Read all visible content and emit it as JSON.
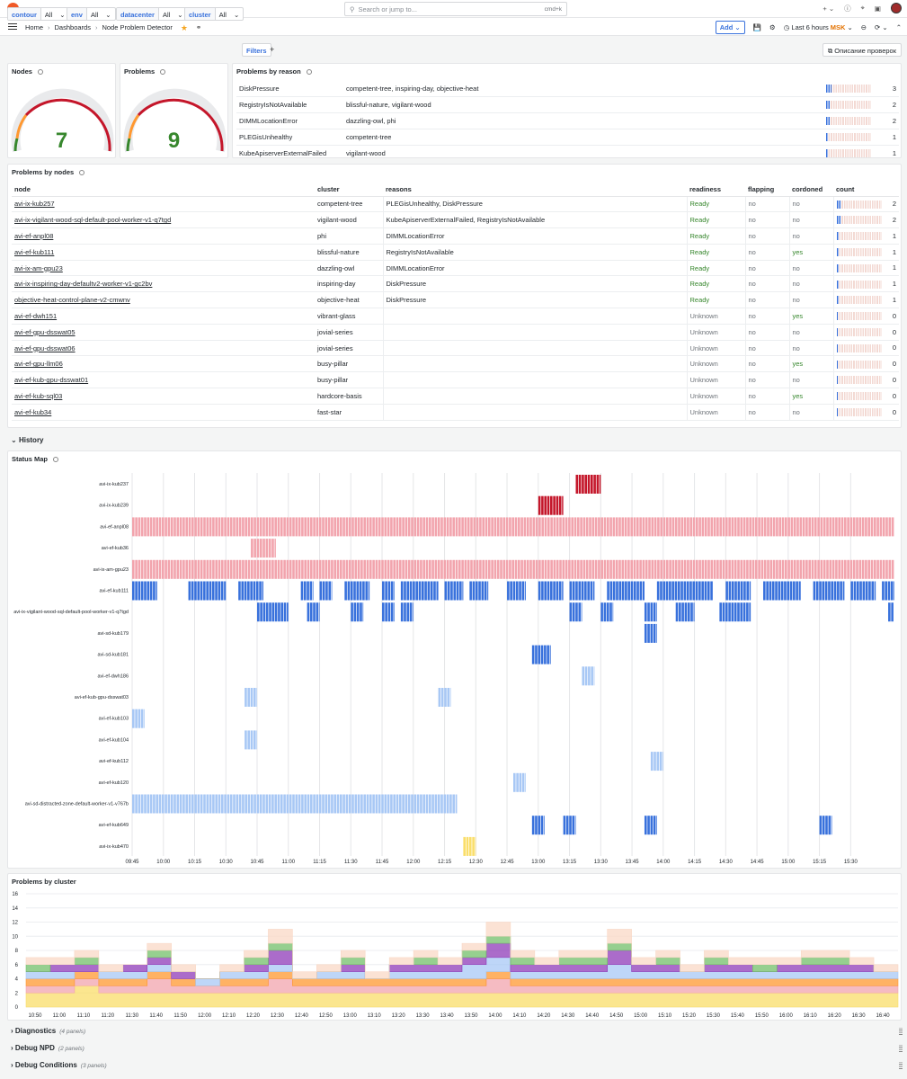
{
  "topbar": {
    "search_placeholder": "Search or jump to...",
    "search_kbd": "cmd+k"
  },
  "nav": {
    "crumbs": [
      "Home",
      "Dashboards",
      "Node Problem Detector"
    ],
    "add_label": "Add",
    "time_range": "Last 6 hours",
    "timezone": "MSK"
  },
  "variables": [
    {
      "name": "contour",
      "value": "All"
    },
    {
      "name": "env",
      "value": "All"
    },
    {
      "name": "datacenter",
      "value": "All"
    },
    {
      "name": "cluster",
      "value": "All"
    }
  ],
  "filters_label": "Filters",
  "desc_button": "Описание проверок",
  "nodes_panel": {
    "title": "Nodes",
    "value": "7"
  },
  "problems_panel": {
    "title": "Problems",
    "value": "9"
  },
  "reasons_panel": {
    "title": "Problems by reason",
    "rows": [
      {
        "reason": "DiskPressure",
        "clusters": "competent-tree, inspiring-day, objective-heat",
        "count": "3",
        "fill": 0.12
      },
      {
        "reason": "RegistryIsNotAvailable",
        "clusters": "blissful-nature, vigilant-wood",
        "count": "2",
        "fill": 0.08
      },
      {
        "reason": "DIMMLocationError",
        "clusters": "dazzling-owl, phi",
        "count": "2",
        "fill": 0.08
      },
      {
        "reason": "PLEGisUnhealthy",
        "clusters": "competent-tree",
        "count": "1",
        "fill": 0.04
      },
      {
        "reason": "KubeApiserverExternalFailed",
        "clusters": "vigilant-wood",
        "count": "1",
        "fill": 0.04
      }
    ]
  },
  "nodes_table": {
    "title": "Problems by nodes",
    "headers": [
      "node",
      "cluster",
      "reasons",
      "readiness",
      "flapping",
      "cordoned",
      "count"
    ],
    "rows": [
      {
        "node": "avi-ix-kub257",
        "cluster": "competent-tree",
        "reasons": "PLEGisUnhealthy, DiskPressure",
        "readiness": "Ready",
        "flapping": "no",
        "cordoned": "no",
        "count": "2",
        "fill": 0.08
      },
      {
        "node": "avi-ix-vigilant-wood-sql-default-pool-worker-v1-q7tgd",
        "cluster": "vigilant-wood",
        "reasons": "KubeApiserverExternalFailed, RegistryIsNotAvailable",
        "readiness": "Ready",
        "flapping": "no",
        "cordoned": "no",
        "count": "2",
        "fill": 0.08
      },
      {
        "node": "avi-ef-anpl08",
        "cluster": "phi",
        "reasons": "DIMMLocationError",
        "readiness": "Ready",
        "flapping": "no",
        "cordoned": "no",
        "count": "1",
        "fill": 0.04
      },
      {
        "node": "avi-ef-kub111",
        "cluster": "blissful-nature",
        "reasons": "RegistryIsNotAvailable",
        "readiness": "Ready",
        "flapping": "no",
        "cordoned": "yes",
        "count": "1",
        "fill": 0.04
      },
      {
        "node": "avi-ix-am-gpu23",
        "cluster": "dazzling-owl",
        "reasons": "DIMMLocationError",
        "readiness": "Ready",
        "flapping": "no",
        "cordoned": "no",
        "count": "1",
        "fill": 0.04
      },
      {
        "node": "avi-ix-inspiring-day-defaultv2-worker-v1-gc2bv",
        "cluster": "inspiring-day",
        "reasons": "DiskPressure",
        "readiness": "Ready",
        "flapping": "no",
        "cordoned": "no",
        "count": "1",
        "fill": 0.04
      },
      {
        "node": "objective-heat-control-plane-v2-cmwnv",
        "cluster": "objective-heat",
        "reasons": "DiskPressure",
        "readiness": "Ready",
        "flapping": "no",
        "cordoned": "no",
        "count": "1",
        "fill": 0.04
      },
      {
        "node": "avi-ef-dwh151",
        "cluster": "vibrant-glass",
        "reasons": "",
        "readiness": "Unknown",
        "flapping": "no",
        "cordoned": "yes",
        "count": "0",
        "fill": 0.03
      },
      {
        "node": "avi-ef-gpu-dsswat05",
        "cluster": "jovial-series",
        "reasons": "",
        "readiness": "Unknown",
        "flapping": "no",
        "cordoned": "no",
        "count": "0",
        "fill": 0.03
      },
      {
        "node": "avi-ef-gpu-dsswat06",
        "cluster": "jovial-series",
        "reasons": "",
        "readiness": "Unknown",
        "flapping": "no",
        "cordoned": "no",
        "count": "0",
        "fill": 0.03
      },
      {
        "node": "avi-ef-gpu-llm06",
        "cluster": "busy-pillar",
        "reasons": "",
        "readiness": "Unknown",
        "flapping": "no",
        "cordoned": "yes",
        "count": "0",
        "fill": 0.03
      },
      {
        "node": "avi-ef-kub-gpu-dsswat01",
        "cluster": "busy-pillar",
        "reasons": "",
        "readiness": "Unknown",
        "flapping": "no",
        "cordoned": "no",
        "count": "0",
        "fill": 0.03
      },
      {
        "node": "avi-ef-kub-sql03",
        "cluster": "hardcore-basis",
        "reasons": "",
        "readiness": "Unknown",
        "flapping": "no",
        "cordoned": "yes",
        "count": "0",
        "fill": 0.03
      },
      {
        "node": "avi-ef-kub34",
        "cluster": "fast-star",
        "reasons": "",
        "readiness": "Unknown",
        "flapping": "no",
        "cordoned": "no",
        "count": "0",
        "fill": 0.03
      }
    ]
  },
  "history_label": "History",
  "status_map": {
    "title": "Status Map",
    "rows": [
      {
        "label": "avi-ix-kub237",
        "color": "#c4162a",
        "segs": [
          [
            13.3,
            13.5
          ]
        ]
      },
      {
        "label": "avi-ix-kub239",
        "color": "#c4162a",
        "segs": [
          [
            13.0,
            13.2
          ]
        ]
      },
      {
        "label": "avi-ef-anpl08",
        "color": "#f2a4ad",
        "segs": [
          [
            9.75,
            15.85
          ]
        ]
      },
      {
        "label": "avi-ef-kub36",
        "color": "#f2a4ad",
        "segs": [
          [
            10.7,
            10.9
          ]
        ]
      },
      {
        "label": "avi-ix-am-gpu23",
        "color": "#f2a4ad",
        "segs": [
          [
            9.75,
            15.85
          ]
        ]
      },
      {
        "label": "avi-ef-kub111",
        "color": "#3871dc",
        "segs": [
          [
            9.75,
            9.95
          ],
          [
            10.2,
            10.5
          ],
          [
            10.6,
            10.8
          ],
          [
            11.1,
            11.2
          ],
          [
            11.25,
            11.35
          ],
          [
            11.45,
            11.65
          ],
          [
            11.75,
            11.85
          ],
          [
            11.9,
            12.2
          ],
          [
            12.25,
            12.4
          ],
          [
            12.45,
            12.6
          ],
          [
            12.75,
            12.9
          ],
          [
            13.0,
            13.2
          ],
          [
            13.25,
            13.45
          ],
          [
            13.55,
            13.85
          ],
          [
            13.95,
            14.4
          ],
          [
            14.5,
            14.7
          ],
          [
            14.8,
            15.1
          ],
          [
            15.2,
            15.45
          ],
          [
            15.5,
            15.7
          ],
          [
            15.75,
            15.85
          ]
        ]
      },
      {
        "label": "avi-ix-vigilant-wood-sql-default-pool-worker-v1-q7tgd",
        "color": "#3871dc",
        "segs": [
          [
            10.75,
            11.0
          ],
          [
            11.15,
            11.25
          ],
          [
            11.5,
            11.6
          ],
          [
            11.75,
            11.85
          ],
          [
            11.9,
            12.0
          ],
          [
            13.25,
            13.35
          ],
          [
            13.5,
            13.6
          ],
          [
            13.85,
            13.95
          ],
          [
            14.1,
            14.25
          ],
          [
            14.45,
            14.7
          ],
          [
            15.8,
            15.85
          ]
        ]
      },
      {
        "label": "avi-sd-kub179",
        "color": "#3871dc",
        "segs": [
          [
            13.85,
            13.95
          ]
        ]
      },
      {
        "label": "avi-sd-kub181",
        "color": "#3871dc",
        "segs": [
          [
            12.95,
            13.1
          ]
        ]
      },
      {
        "label": "avi-ef-dwh186",
        "color": "#a8c8f5",
        "segs": [
          [
            13.35,
            13.45
          ]
        ]
      },
      {
        "label": "avi-ef-kub-gpu-dsswat03",
        "color": "#a8c8f5",
        "segs": [
          [
            10.65,
            10.75
          ],
          [
            12.2,
            12.3
          ]
        ]
      },
      {
        "label": "avi-ef-kub103",
        "color": "#a8c8f5",
        "segs": [
          [
            9.75,
            9.85
          ]
        ]
      },
      {
        "label": "avi-ef-kub104",
        "color": "#a8c8f5",
        "segs": [
          [
            10.65,
            10.75
          ]
        ]
      },
      {
        "label": "avi-ef-kub112",
        "color": "#a8c8f5",
        "segs": [
          [
            13.9,
            14.0
          ]
        ]
      },
      {
        "label": "avi-ef-kub120",
        "color": "#a8c8f5",
        "segs": [
          [
            12.8,
            12.9
          ]
        ]
      },
      {
        "label": "avi-sd-distracted-zone-default-worker-v1-v767b",
        "color": "#a8c8f5",
        "segs": [
          [
            9.75,
            12.35
          ]
        ]
      },
      {
        "label": "avi-ef-kub649",
        "color": "#3871dc",
        "segs": [
          [
            12.95,
            13.05
          ],
          [
            13.2,
            13.3
          ],
          [
            13.85,
            13.95
          ],
          [
            15.25,
            15.35
          ]
        ]
      },
      {
        "label": "avi-ix-kub470",
        "color": "#fade6a",
        "segs": [
          [
            12.4,
            12.5
          ]
        ]
      }
    ],
    "x_ticks": [
      "09:45",
      "10:00",
      "10:15",
      "10:30",
      "10:45",
      "11:00",
      "11:15",
      "11:30",
      "11:45",
      "12:00",
      "12:15",
      "12:30",
      "12:45",
      "13:00",
      "13:15",
      "13:30",
      "13:45",
      "14:00",
      "14:15",
      "14:30",
      "14:45",
      "15:00",
      "15:15",
      "15:30"
    ]
  },
  "chart_data": {
    "type": "area",
    "title": "Problems by cluster",
    "ylim": [
      0,
      16
    ],
    "y_ticks": [
      "0",
      "2",
      "4",
      "6",
      "8",
      "10",
      "12",
      "14",
      "16"
    ],
    "x_ticks": [
      "10:50",
      "11:00",
      "11:10",
      "11:20",
      "11:30",
      "11:40",
      "11:50",
      "12:00",
      "12:10",
      "12:20",
      "12:30",
      "12:40",
      "12:50",
      "13:00",
      "13:10",
      "13:20",
      "13:30",
      "13:40",
      "13:50",
      "14:00",
      "14:10",
      "14:20",
      "14:30",
      "14:40",
      "14:50",
      "15:00",
      "15:10",
      "15:20",
      "15:30",
      "15:40",
      "15:50",
      "16:00",
      "16:10",
      "16:20",
      "16:30",
      "16:40"
    ],
    "series": [
      {
        "color": "#fade6a",
        "values": [
          2,
          2,
          3,
          2,
          2,
          2,
          2,
          2,
          2,
          2,
          2,
          2,
          2,
          2,
          2,
          2,
          2,
          2,
          2,
          2,
          2,
          2,
          2,
          2,
          2,
          2,
          2,
          2,
          2,
          2,
          2,
          2,
          2,
          2,
          2,
          2
        ]
      },
      {
        "color": "#f2a4ad",
        "values": [
          1,
          1,
          1,
          1,
          1,
          2,
          1,
          1,
          1,
          1,
          2,
          1,
          1,
          1,
          1,
          1,
          1,
          1,
          1,
          2,
          1,
          1,
          1,
          1,
          1,
          1,
          1,
          1,
          1,
          1,
          1,
          1,
          1,
          1,
          1,
          1
        ]
      },
      {
        "color": "#ff9830",
        "values": [
          1,
          1,
          1,
          1,
          1,
          1,
          1,
          0,
          1,
          1,
          1,
          1,
          1,
          1,
          1,
          1,
          1,
          1,
          1,
          1,
          1,
          1,
          1,
          1,
          1,
          1,
          1,
          1,
          1,
          1,
          1,
          1,
          1,
          1,
          1,
          1
        ]
      },
      {
        "color": "#a8c8f5",
        "values": [
          1,
          1,
          0,
          1,
          1,
          1,
          0,
          1,
          1,
          1,
          1,
          0,
          1,
          1,
          0,
          1,
          1,
          1,
          2,
          2,
          1,
          1,
          1,
          1,
          2,
          1,
          1,
          1,
          1,
          1,
          1,
          1,
          1,
          1,
          1,
          1
        ]
      },
      {
        "color": "#8f3bb8",
        "values": [
          0,
          1,
          1,
          0,
          1,
          1,
          1,
          0,
          0,
          1,
          2,
          0,
          0,
          1,
          0,
          1,
          1,
          1,
          1,
          2,
          1,
          1,
          1,
          1,
          2,
          1,
          1,
          0,
          1,
          1,
          0,
          1,
          1,
          1,
          1,
          0
        ]
      },
      {
        "color": "#73bf69",
        "values": [
          1,
          0,
          1,
          0,
          0,
          1,
          0,
          0,
          0,
          1,
          1,
          0,
          0,
          1,
          0,
          0,
          1,
          0,
          1,
          1,
          1,
          0,
          1,
          1,
          1,
          0,
          1,
          0,
          1,
          0,
          1,
          0,
          1,
          1,
          0,
          0
        ]
      },
      {
        "color": "#f9d8c6",
        "values": [
          1,
          1,
          1,
          1,
          0,
          1,
          1,
          0,
          1,
          1,
          2,
          1,
          1,
          1,
          1,
          1,
          1,
          1,
          1,
          2,
          1,
          1,
          1,
          1,
          2,
          1,
          1,
          1,
          1,
          1,
          1,
          1,
          1,
          1,
          1,
          1
        ]
      }
    ]
  },
  "sections": [
    {
      "label": "Diagnostics",
      "count": "(4 panels)"
    },
    {
      "label": "Debug NPD",
      "count": "(2 panels)"
    },
    {
      "label": "Debug Conditions",
      "count": "(3 panels)"
    }
  ]
}
